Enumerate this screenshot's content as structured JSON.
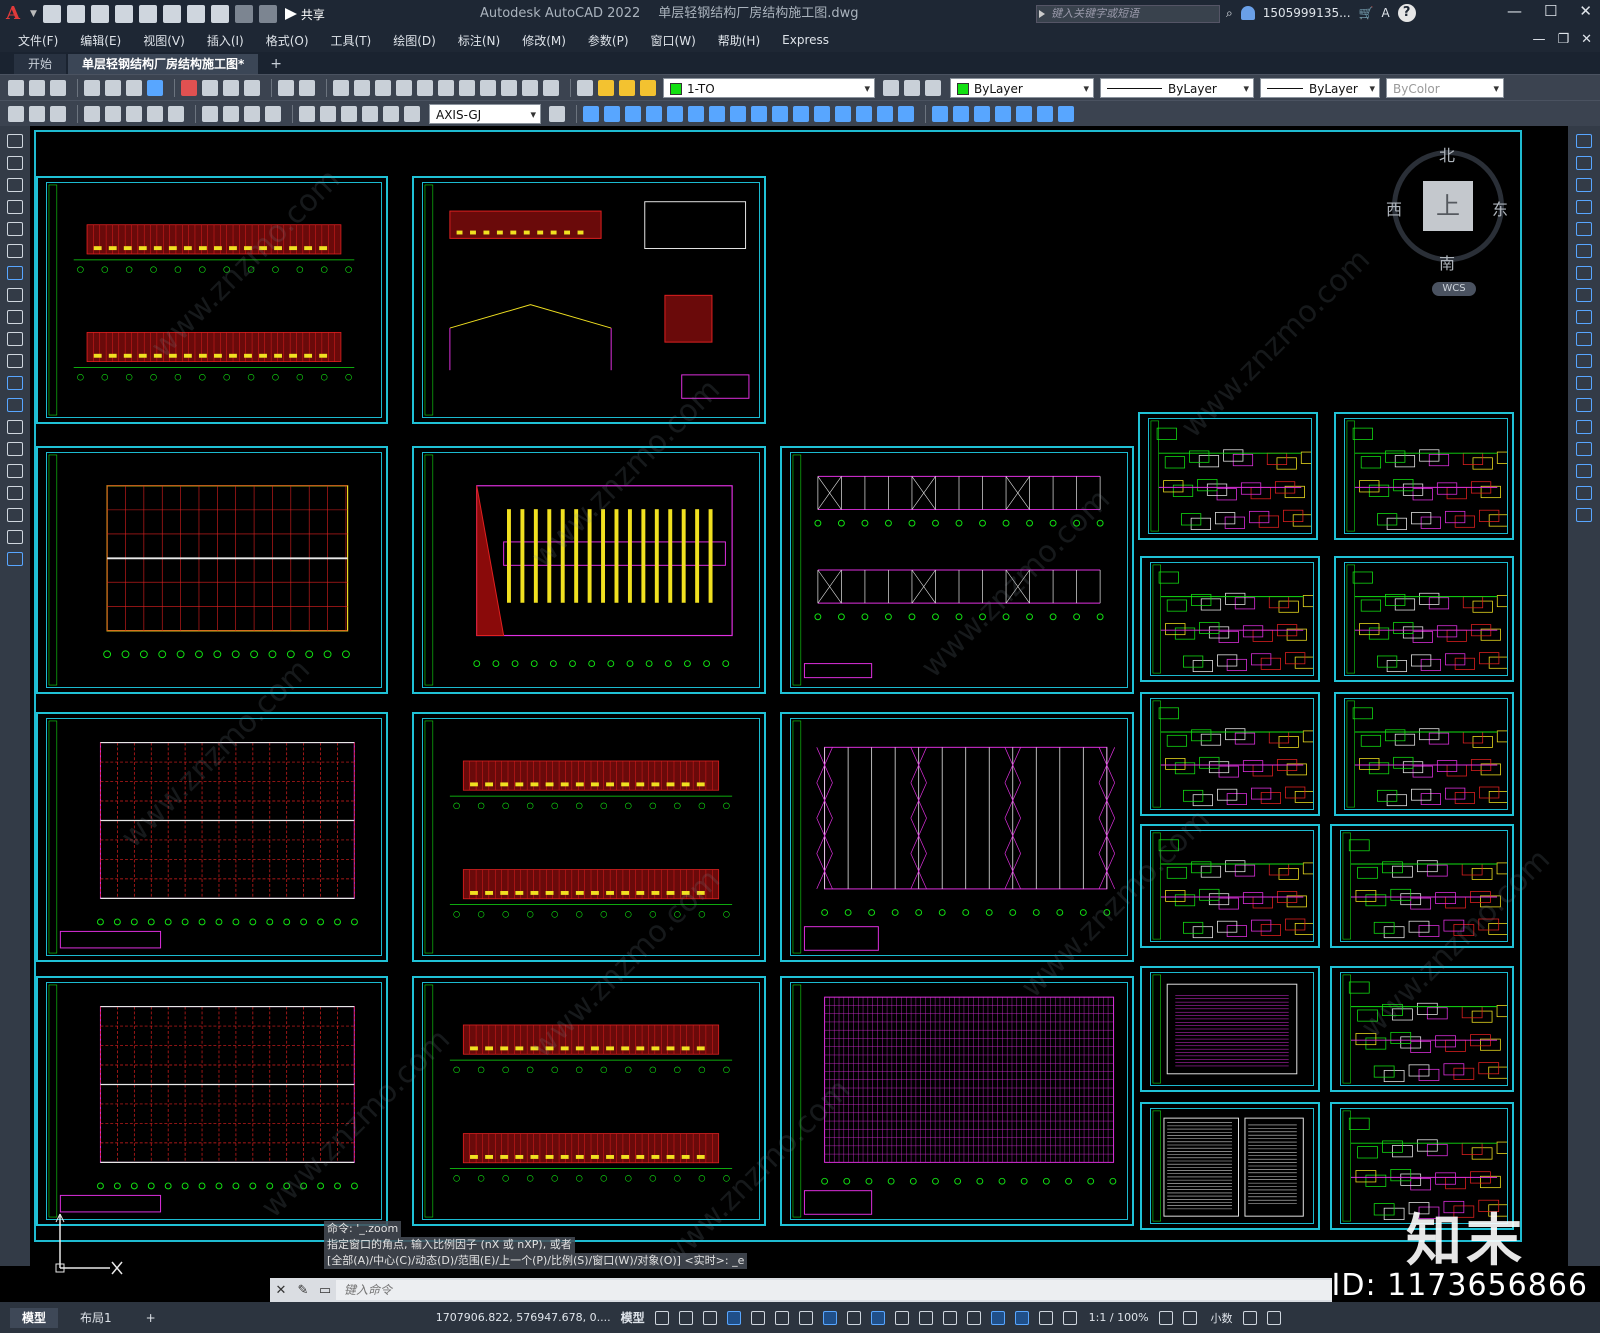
{
  "titlebar": {
    "app_logo": "A",
    "share_label": "共享",
    "app_name": "Autodesk AutoCAD 2022",
    "file_name": "单层轻钢结构厂房结构施工图.dwg",
    "search_placeholder": "键入关键字或短语",
    "user": "1505999135...",
    "help": "?",
    "minimize": "—",
    "maximize": "☐",
    "close": "✕"
  },
  "menubar": {
    "items": [
      "文件(F)",
      "编辑(E)",
      "视图(V)",
      "插入(I)",
      "格式(O)",
      "工具(T)",
      "绘图(D)",
      "标注(N)",
      "修改(M)",
      "参数(P)",
      "窗口(W)",
      "帮助(H)",
      "Express"
    ],
    "mdi_minimize": "—",
    "mdi_restore": "❐",
    "mdi_close": "✕"
  },
  "tabs": {
    "start": "开始",
    "file_tab": "单层轻钢结构厂房结构施工图*",
    "add": "+"
  },
  "toolbar": {
    "layer": "1-TO",
    "color": "ByLayer",
    "linetype": "ByLayer",
    "lineweight": "ByLayer",
    "plotstyle": "ByColor",
    "dimstyle": "AXIS-GJ",
    "layer_color": "#12e012"
  },
  "viewcube": {
    "north": "北",
    "south": "南",
    "east": "东",
    "west": "西",
    "face": "上",
    "wcs": "WCS"
  },
  "command": {
    "history": [
      "命令: '_.zoom",
      "指定窗口的角点, 输入比例因子 (nX 或 nXP), 或者",
      "[全部(A)/中心(C)/动态(D)/范围(E)/上一个(P)/比例(S)/窗口(W)/对象(O)] <实时>: _e"
    ],
    "placeholder": "键入命令",
    "close": "✕"
  },
  "statusbar": {
    "model_tab": "模型",
    "layout_tab": "布局1",
    "add": "+",
    "coords": "1707906.822, 576947.678, 0....",
    "model": "模型",
    "scale": "1:1 / 100%",
    "units": "小数"
  },
  "watermark": {
    "logo": "知末",
    "id": "ID: 1173656866",
    "site": "www.znzmo.com"
  },
  "colors": {
    "frame": "#20c2d6",
    "green": "#12e012",
    "magenta": "#e030e0",
    "red": "#e02020",
    "yellow": "#f0e020",
    "accent": "#58a6ff"
  }
}
